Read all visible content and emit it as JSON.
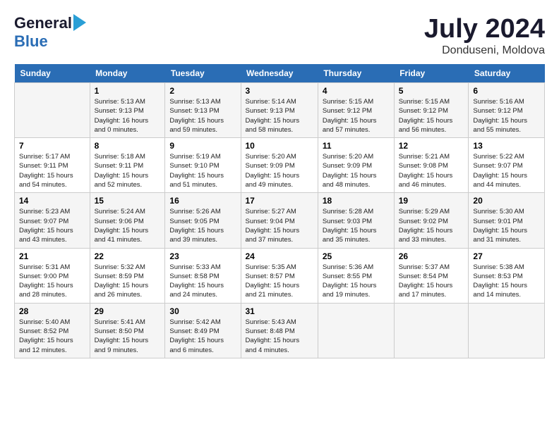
{
  "header": {
    "logo_general": "General",
    "logo_blue": "Blue",
    "title": "July 2024",
    "subtitle": "Donduseni, Moldova"
  },
  "calendar": {
    "weekdays": [
      "Sunday",
      "Monday",
      "Tuesday",
      "Wednesday",
      "Thursday",
      "Friday",
      "Saturday"
    ],
    "weeks": [
      [
        {
          "day": "",
          "info": ""
        },
        {
          "day": "1",
          "info": "Sunrise: 5:13 AM\nSunset: 9:13 PM\nDaylight: 16 hours\nand 0 minutes."
        },
        {
          "day": "2",
          "info": "Sunrise: 5:13 AM\nSunset: 9:13 PM\nDaylight: 15 hours\nand 59 minutes."
        },
        {
          "day": "3",
          "info": "Sunrise: 5:14 AM\nSunset: 9:13 PM\nDaylight: 15 hours\nand 58 minutes."
        },
        {
          "day": "4",
          "info": "Sunrise: 5:15 AM\nSunset: 9:12 PM\nDaylight: 15 hours\nand 57 minutes."
        },
        {
          "day": "5",
          "info": "Sunrise: 5:15 AM\nSunset: 9:12 PM\nDaylight: 15 hours\nand 56 minutes."
        },
        {
          "day": "6",
          "info": "Sunrise: 5:16 AM\nSunset: 9:12 PM\nDaylight: 15 hours\nand 55 minutes."
        }
      ],
      [
        {
          "day": "7",
          "info": "Sunrise: 5:17 AM\nSunset: 9:11 PM\nDaylight: 15 hours\nand 54 minutes."
        },
        {
          "day": "8",
          "info": "Sunrise: 5:18 AM\nSunset: 9:11 PM\nDaylight: 15 hours\nand 52 minutes."
        },
        {
          "day": "9",
          "info": "Sunrise: 5:19 AM\nSunset: 9:10 PM\nDaylight: 15 hours\nand 51 minutes."
        },
        {
          "day": "10",
          "info": "Sunrise: 5:20 AM\nSunset: 9:09 PM\nDaylight: 15 hours\nand 49 minutes."
        },
        {
          "day": "11",
          "info": "Sunrise: 5:20 AM\nSunset: 9:09 PM\nDaylight: 15 hours\nand 48 minutes."
        },
        {
          "day": "12",
          "info": "Sunrise: 5:21 AM\nSunset: 9:08 PM\nDaylight: 15 hours\nand 46 minutes."
        },
        {
          "day": "13",
          "info": "Sunrise: 5:22 AM\nSunset: 9:07 PM\nDaylight: 15 hours\nand 44 minutes."
        }
      ],
      [
        {
          "day": "14",
          "info": "Sunrise: 5:23 AM\nSunset: 9:07 PM\nDaylight: 15 hours\nand 43 minutes."
        },
        {
          "day": "15",
          "info": "Sunrise: 5:24 AM\nSunset: 9:06 PM\nDaylight: 15 hours\nand 41 minutes."
        },
        {
          "day": "16",
          "info": "Sunrise: 5:26 AM\nSunset: 9:05 PM\nDaylight: 15 hours\nand 39 minutes."
        },
        {
          "day": "17",
          "info": "Sunrise: 5:27 AM\nSunset: 9:04 PM\nDaylight: 15 hours\nand 37 minutes."
        },
        {
          "day": "18",
          "info": "Sunrise: 5:28 AM\nSunset: 9:03 PM\nDaylight: 15 hours\nand 35 minutes."
        },
        {
          "day": "19",
          "info": "Sunrise: 5:29 AM\nSunset: 9:02 PM\nDaylight: 15 hours\nand 33 minutes."
        },
        {
          "day": "20",
          "info": "Sunrise: 5:30 AM\nSunset: 9:01 PM\nDaylight: 15 hours\nand 31 minutes."
        }
      ],
      [
        {
          "day": "21",
          "info": "Sunrise: 5:31 AM\nSunset: 9:00 PM\nDaylight: 15 hours\nand 28 minutes."
        },
        {
          "day": "22",
          "info": "Sunrise: 5:32 AM\nSunset: 8:59 PM\nDaylight: 15 hours\nand 26 minutes."
        },
        {
          "day": "23",
          "info": "Sunrise: 5:33 AM\nSunset: 8:58 PM\nDaylight: 15 hours\nand 24 minutes."
        },
        {
          "day": "24",
          "info": "Sunrise: 5:35 AM\nSunset: 8:57 PM\nDaylight: 15 hours\nand 21 minutes."
        },
        {
          "day": "25",
          "info": "Sunrise: 5:36 AM\nSunset: 8:55 PM\nDaylight: 15 hours\nand 19 minutes."
        },
        {
          "day": "26",
          "info": "Sunrise: 5:37 AM\nSunset: 8:54 PM\nDaylight: 15 hours\nand 17 minutes."
        },
        {
          "day": "27",
          "info": "Sunrise: 5:38 AM\nSunset: 8:53 PM\nDaylight: 15 hours\nand 14 minutes."
        }
      ],
      [
        {
          "day": "28",
          "info": "Sunrise: 5:40 AM\nSunset: 8:52 PM\nDaylight: 15 hours\nand 12 minutes."
        },
        {
          "day": "29",
          "info": "Sunrise: 5:41 AM\nSunset: 8:50 PM\nDaylight: 15 hours\nand 9 minutes."
        },
        {
          "day": "30",
          "info": "Sunrise: 5:42 AM\nSunset: 8:49 PM\nDaylight: 15 hours\nand 6 minutes."
        },
        {
          "day": "31",
          "info": "Sunrise: 5:43 AM\nSunset: 8:48 PM\nDaylight: 15 hours\nand 4 minutes."
        },
        {
          "day": "",
          "info": ""
        },
        {
          "day": "",
          "info": ""
        },
        {
          "day": "",
          "info": ""
        }
      ]
    ]
  }
}
